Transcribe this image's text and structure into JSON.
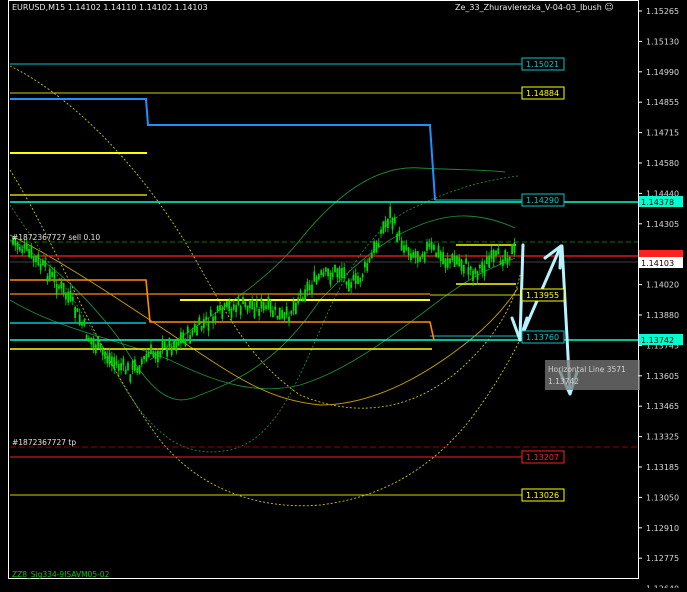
{
  "header": {
    "symbol_info": "EURUSD,M15  1.14102 1.14110 1.14102 1.14103",
    "indicator": "Ze_33_Zhuravlerezka_V-04-03_Ibush"
  },
  "smiley_icon": "smiley-icon",
  "price_axis": {
    "labels": [
      "1.15265",
      "1.15130",
      "1.14990",
      "1.14855",
      "1.14715",
      "1.14580",
      "1.14440",
      "1.14305",
      "1.14165",
      "1.14020",
      "1.13880",
      "1.13745",
      "1.13605",
      "1.13465",
      "1.13325",
      "1.13185",
      "1.13050",
      "1.12910",
      "1.12775",
      "1.12640"
    ],
    "current_price": "1.14103"
  },
  "levels": [
    {
      "name": "level-1-15021",
      "label": "1.15021",
      "color": "#00c8c8"
    },
    {
      "name": "level-1-14884",
      "label": "1.14884",
      "color": "#ffff00"
    },
    {
      "name": "level-1-14378",
      "label": "1.14378",
      "color": "#00ffcc"
    },
    {
      "name": "level-1-14290",
      "label": "1.14290",
      "color": "#00c8c8"
    },
    {
      "name": "level-1-13955",
      "label": "1.13955",
      "color": "#ffff00"
    },
    {
      "name": "level-1-13742",
      "label": "1.13742",
      "color": "#00ffcc"
    },
    {
      "name": "level-1-13760",
      "label": "1.13760",
      "color": "#00c8c8"
    },
    {
      "name": "level-1-13207",
      "label": "1.13207",
      "color": "#ff2020"
    },
    {
      "name": "level-1-13026",
      "label": "1.13026",
      "color": "#ffff00"
    }
  ],
  "orders": {
    "sell_label": "#1872367727 sell 0.10",
    "tp_label": "#1872367727 tp"
  },
  "tooltip": {
    "line1": "Horizontal Line 3571",
    "line2": "1.13742"
  },
  "footer_indicator": "ZZ8_Sig334-9ISAVM05-02",
  "colors": {
    "candle": "#00dc00",
    "cyan_line": "#00c8c8",
    "yellow_line": "#ffff00",
    "orange_line": "#ff8c00",
    "blue_line": "#1e90ff",
    "red_line": "#ff2020",
    "arrow": "#b8f4ff"
  }
}
